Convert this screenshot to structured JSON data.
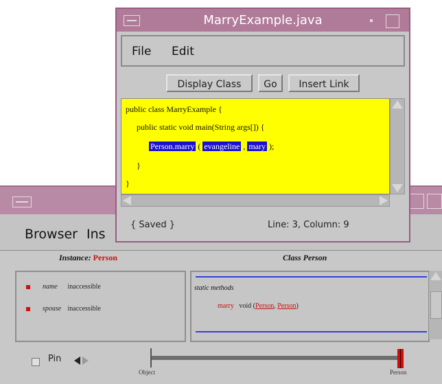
{
  "browser": {
    "menu": [
      "Browser",
      "Ins"
    ],
    "instance_header": {
      "label": "Instance:",
      "value": "Person"
    },
    "class_header": "Class Person",
    "instance_rows": [
      {
        "name": "name",
        "value": "inaccessible"
      },
      {
        "name": "spouse",
        "value": "inaccessible"
      }
    ],
    "class_panel": {
      "section": "static methods",
      "method_name": "marry",
      "method_sig_prefix": "void (",
      "param1": "Person",
      "sep": ", ",
      "param2": "Person",
      "method_sig_suffix": ")"
    },
    "pin_label": "Pin",
    "slider": {
      "left_label": "Object",
      "right_label": "Person",
      "position_fraction": 0.97
    }
  },
  "editor": {
    "title": "MarryExample.java",
    "menu": [
      "File",
      "Edit"
    ],
    "buttons": [
      "Display Class",
      "Go",
      "Insert Link"
    ],
    "code": {
      "line1": "public class MarryExample {",
      "line2": "public static void main(String args[]) {",
      "call": "Person.marry",
      "open_paren": " ( ",
      "arg1": "evangeline",
      "comma": " , ",
      "arg2": "mary",
      "close": " );",
      "line4": "}",
      "line5": "}"
    },
    "status_left": "{ Saved }",
    "status_right": "Line: 3, Column: 9"
  },
  "colors": {
    "code_bg": "#ffff00",
    "highlight": "#1a10d0",
    "title_bar": "#b07b99",
    "accent_red": "#c81010"
  }
}
